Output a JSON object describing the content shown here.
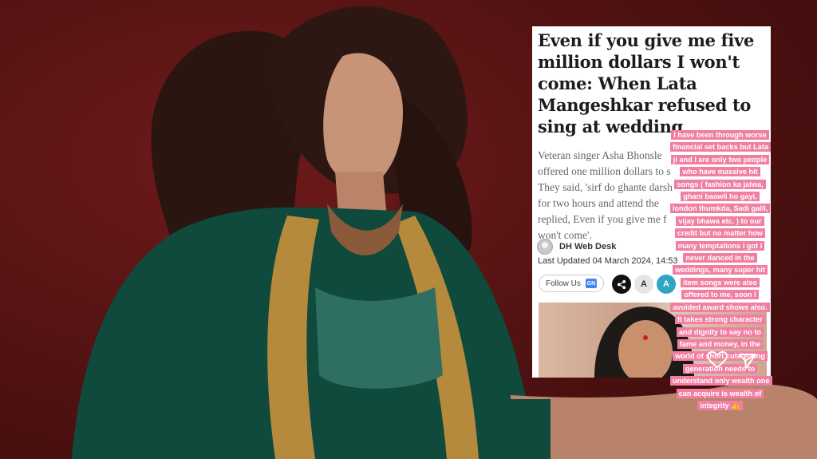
{
  "article": {
    "headline": "Even if you give me five million dollars I won't come: When Lata Mangeshkar refused to sing at wedding",
    "body": "Veteran singer Asha Bhonsle\noffered one million dollars to s\nThey said, 'sirf do ghante darsh\nfor two hours and attend the\nreplied, Even if you give me f\nwon't come'.",
    "author": "DH Web Desk",
    "updated": "Last Updated 04 March 2024, 14:53",
    "follow_label": "Follow Us",
    "gnews_label": "GN",
    "font_small": "A",
    "font_large": "A"
  },
  "story_text": "I have been through worse financial set backs but Lata ji and I are only two people who have massive hit songs ( fashion ka jalwa, ghani baawli ho gayi, london thumkda, Sadi galli, vijay bhawa etc. ) to our credit but no matter how many temptations I got I never danced in the weddings, many super hit item songs were also offered to me, soon I avoided award shows also. It takes strong character and dignity to say no to fame and money, in the world of short cuts young generation needs to understand only wealth one can acquire is wealth of integrity 👍",
  "icons": {
    "like": "heart-icon",
    "send": "send-icon",
    "share": "share-icon",
    "avatar": "author-avatar-icon"
  },
  "colors": {
    "background": "#5a1414",
    "dress": "#0f4a3c",
    "gold_trim": "#b58a3c",
    "story_highlight": "#f07fa2"
  }
}
